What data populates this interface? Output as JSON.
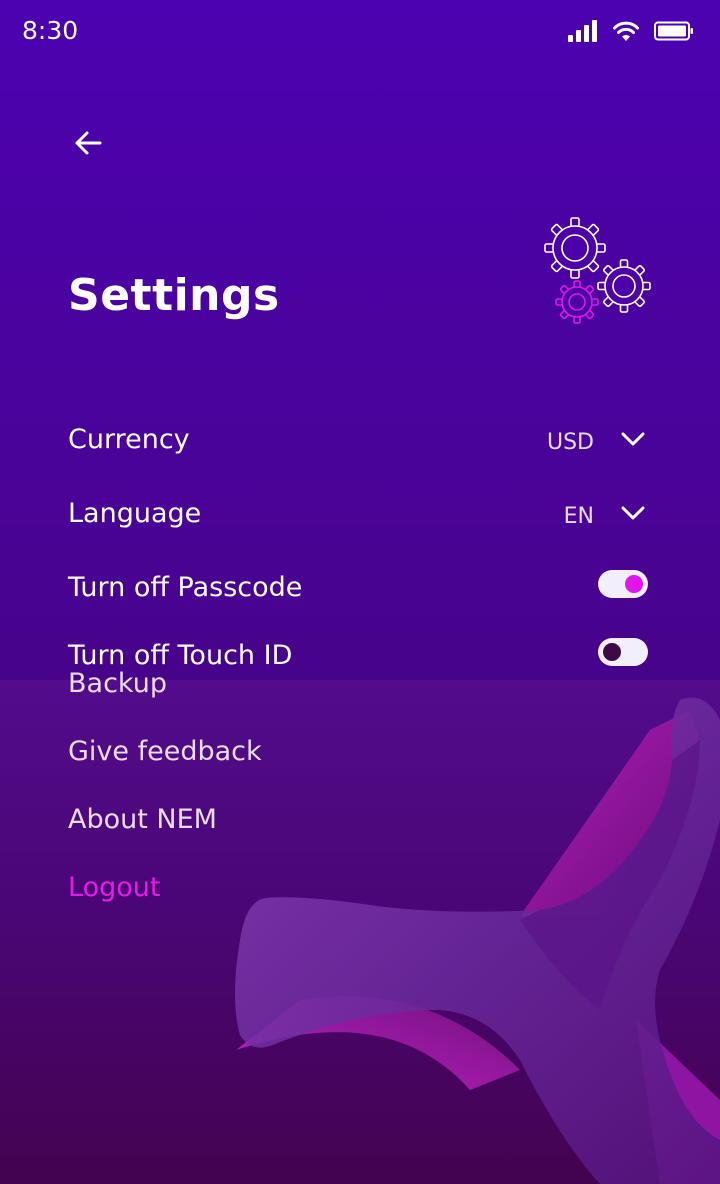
{
  "status": {
    "time": "8:30"
  },
  "page": {
    "title": "Settings"
  },
  "settings": {
    "currency": {
      "label": "Currency",
      "value": "USD"
    },
    "language": {
      "label": "Language",
      "value": "EN"
    },
    "passcode": {
      "label": "Turn off Passcode",
      "enabled": true
    },
    "touch_id": {
      "label": "Turn off Touch ID",
      "enabled": false
    }
  },
  "menu": {
    "backup": "Backup",
    "feedback": "Give feedback",
    "about": "About NEM",
    "logout": "Logout"
  },
  "colors": {
    "accent": "#e115e9",
    "background_top": "#4c02b0",
    "background_bottom": "#44034f"
  },
  "icons": [
    "signal-icon",
    "wifi-icon",
    "battery-icon",
    "back-arrow-icon",
    "gears-icon",
    "chevron-down-icon"
  ]
}
